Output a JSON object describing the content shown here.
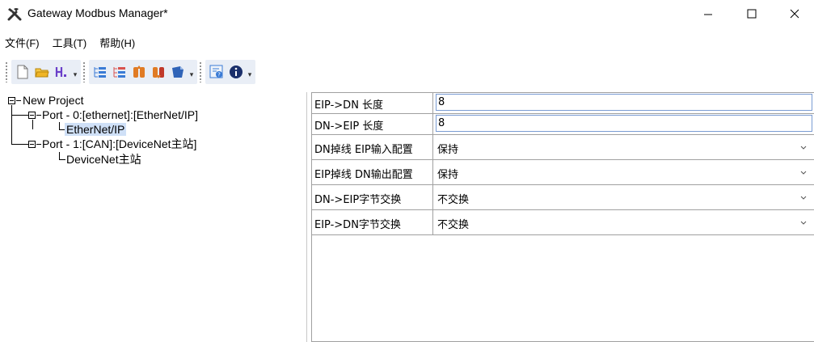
{
  "window": {
    "title": "Gateway Modbus Manager*",
    "icon": "tools-icon",
    "controls": [
      "minimize",
      "maximize",
      "close"
    ]
  },
  "menu": [
    "文件(F)",
    "工具(T)",
    "帮助(H)"
  ],
  "toolbar": {
    "groups": [
      [
        "new-file-icon",
        "open-folder-icon",
        "save-icon"
      ],
      [
        "add-node-icon",
        "remove-node-icon",
        "upload-icon",
        "download-icon",
        "chip-icon"
      ],
      [
        "help-icon",
        "info-icon"
      ]
    ]
  },
  "tree": {
    "root": "New Project",
    "ports": [
      {
        "label": "Port - 0:[ethernet]:[EtherNet/IP]",
        "child": "EtherNet/IP",
        "child_selected": true
      },
      {
        "label": "Port - 1:[CAN]:[DeviceNet主站]",
        "child": "DeviceNet主站",
        "child_selected": false
      }
    ]
  },
  "properties": [
    {
      "name": "EIP->DN 长度",
      "type": "input",
      "value": "8"
    },
    {
      "name": "DN->EIP 长度",
      "type": "input",
      "value": "8"
    },
    {
      "name": "DN掉线 EIP输入配置",
      "type": "select",
      "value": "保持"
    },
    {
      "name": "EIP掉线 DN输出配置",
      "type": "select",
      "value": "保持"
    },
    {
      "name": "DN->EIP字节交换",
      "type": "select",
      "value": "不交换"
    },
    {
      "name": "EIP->DN字节交换",
      "type": "select",
      "value": "不交换"
    }
  ],
  "colors": {
    "selection": "#cfe0f7",
    "toolbar_bg": "#e9eef6",
    "grid_border": "#a0a0a0"
  }
}
